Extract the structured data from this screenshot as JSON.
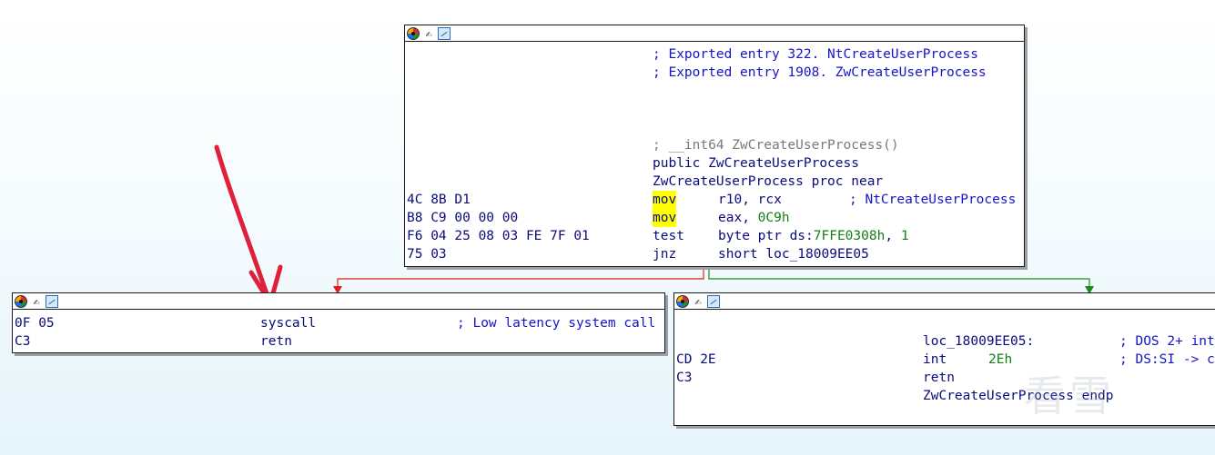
{
  "top_block": {
    "comment1": "; Exported entry 322. NtCreateUserProcess",
    "comment2": "; Exported entry 1908. ZwCreateUserProcess",
    "decl": "; __int64 ZwCreateUserProcess()",
    "public": "public ZwCreateUserProcess",
    "proc": "ZwCreateUserProcess proc near",
    "rows": [
      {
        "bytes": "4C 8B D1",
        "mnem": "mov",
        "op1": "r10, rcx",
        "op2": "",
        "cmt": "; NtCreateUserProcess"
      },
      {
        "bytes": "B8 C9 00 00 00",
        "mnem": "mov",
        "op1": "eax, ",
        "op2": "0C9h",
        "cmt": ""
      },
      {
        "bytes": "F6 04 25 08 03 FE 7F 01",
        "mnem": "test",
        "op1": "byte ptr ds:",
        "op2": "7FFE0308h",
        "op3": ", ",
        "op4": "1",
        "cmt": ""
      },
      {
        "bytes": "75 03",
        "mnem": "jnz",
        "op1": "short loc_18009EE05",
        "op2": "",
        "cmt": ""
      }
    ]
  },
  "left_block": {
    "rows": [
      {
        "bytes": "0F 05",
        "mnem": "syscall",
        "cmt": "; Low latency system call"
      },
      {
        "bytes": "C3",
        "mnem": "retn",
        "cmt": ""
      }
    ]
  },
  "right_block": {
    "label": "loc_18009EE05:",
    "label_cmt": "; DOS 2+ int",
    "rows": [
      {
        "bytes": "CD 2E",
        "mnem": "int",
        "op": "2Eh",
        "cmt": "; DS:SI -> c"
      },
      {
        "bytes": "C3",
        "mnem": "retn",
        "op": "",
        "cmt": ""
      }
    ],
    "endp": "ZwCreateUserProcess endp"
  },
  "watermark": "看雪",
  "colors": {
    "branch_false": "#e02020",
    "branch_true": "#1c8c1c",
    "annotation": "#e0203a"
  }
}
